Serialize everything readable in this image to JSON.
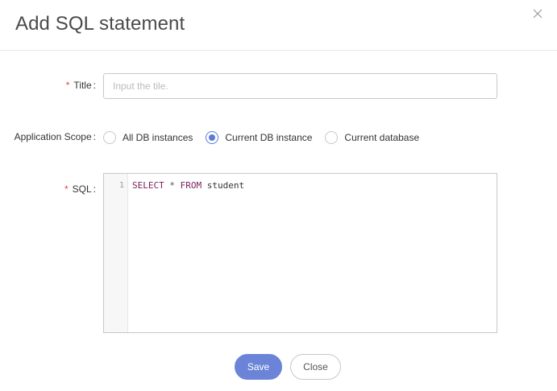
{
  "dialog": {
    "title": "Add SQL statement"
  },
  "form": {
    "title_field": {
      "required_mark": "*",
      "label": "Title",
      "colon": ":",
      "value": "",
      "placeholder": "Input the tile."
    },
    "scope_field": {
      "label": "Application Scope",
      "colon": ":",
      "options": [
        {
          "label": "All DB instances",
          "checked": false
        },
        {
          "label": "Current DB instance",
          "checked": true
        },
        {
          "label": "Current database",
          "checked": false
        }
      ]
    },
    "sql_field": {
      "required_mark": "*",
      "label": "SQL",
      "colon": ":",
      "line_number": "1",
      "code_tokens": {
        "kw1": "SELECT",
        "op": "*",
        "kw2": "FROM",
        "ident": "student"
      }
    }
  },
  "buttons": {
    "save_label": "Save",
    "close_label": "Close"
  },
  "colors": {
    "accent": "#6b84d8",
    "required": "#e0464b",
    "keyword": "#7a1f5a"
  },
  "icons": {
    "close": "close-icon"
  }
}
